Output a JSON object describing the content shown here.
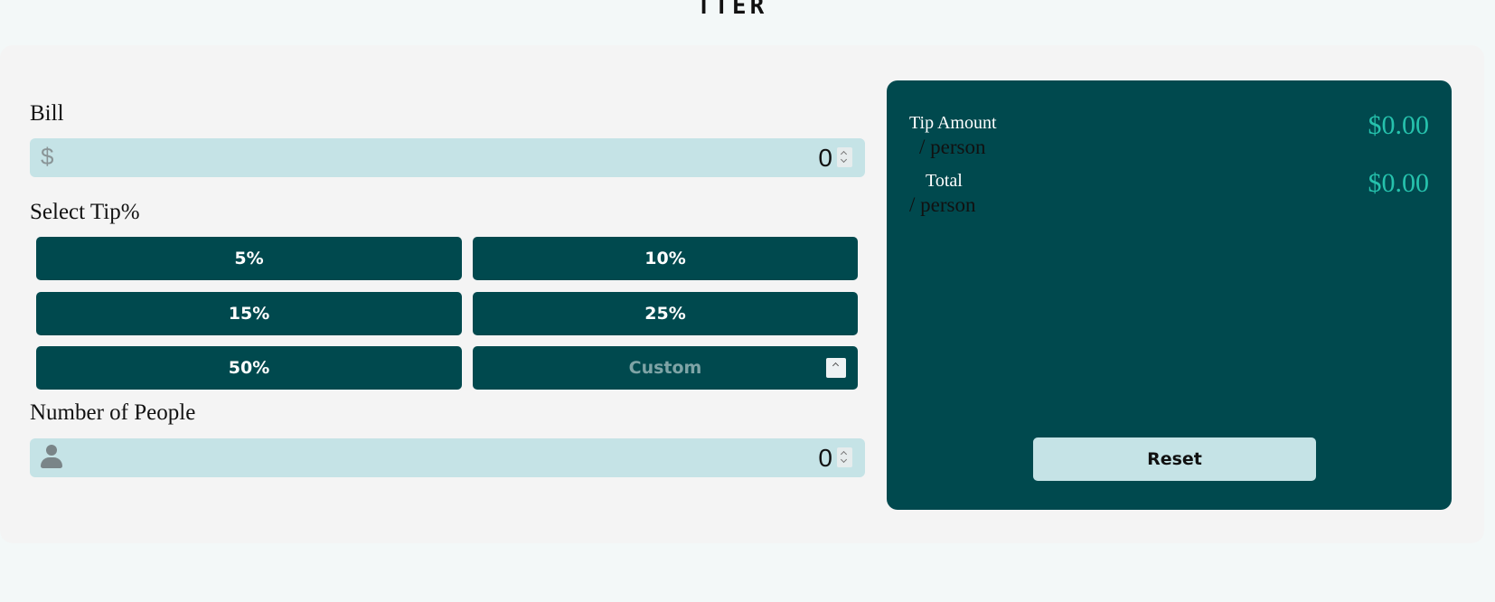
{
  "app": {
    "logo_text": "TTER"
  },
  "bill": {
    "label": "Bill",
    "prefix": "$",
    "value": "0"
  },
  "tip": {
    "label": "Select Tip%",
    "options": [
      "5%",
      "10%",
      "15%",
      "25%",
      "50%"
    ],
    "custom_placeholder": "Custom"
  },
  "people": {
    "label": "Number of People",
    "value": "0",
    "icon": "person-icon"
  },
  "results": {
    "tip_amount_label": "Tip Amount",
    "tip_amount_sub": "/ person",
    "tip_amount_value": "$0.00",
    "total_label": "Total",
    "total_sub": "/ person",
    "total_value": "$0.00",
    "reset_label": "Reset"
  },
  "colors": {
    "page_bg": "#f3f8f8",
    "card_bg": "#f4f4f4",
    "dark_cyan": "#00494e",
    "light_cyan": "#c5e3e6",
    "accent": "#26c2ad"
  }
}
